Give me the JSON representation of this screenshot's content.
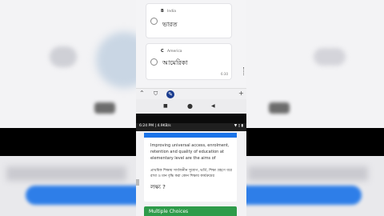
{
  "quiz_top": {
    "option_b": {
      "letter": "B",
      "english": "India",
      "bengali": "ভারত"
    },
    "option_c": {
      "letter": "C",
      "english": "America",
      "bengali": "আমেরিকা",
      "time": "6:30"
    }
  },
  "toolbar": {
    "left": "⌃",
    "mid_icon": "shield-icon",
    "right": "+"
  },
  "navbar": {
    "stop": "■",
    "home": "●",
    "back": "◀"
  },
  "status": {
    "time": "6:24 PM | 4.9KB/s",
    "icons": "▼ ▯ ▮"
  },
  "question": {
    "english": "Improving universal access, enrolment, retention and quality of education at elementary level are the aims of",
    "bengali": "প্রাথমিক শিক্ষায় সার্বজনীন সুযোগ, ভর্তি, শিক্ষা গ্রহণে ধরে রাখা ও মান বৃদ্ধি করা কোন শিক্ষায় কার্যক্রমের",
    "bengali_2": "লক্ষ্য ?"
  },
  "chip": {
    "label": "Multiple Choices"
  },
  "colors": {
    "accent_blue": "#1a73e8",
    "chip_green": "#2e9b4a"
  }
}
